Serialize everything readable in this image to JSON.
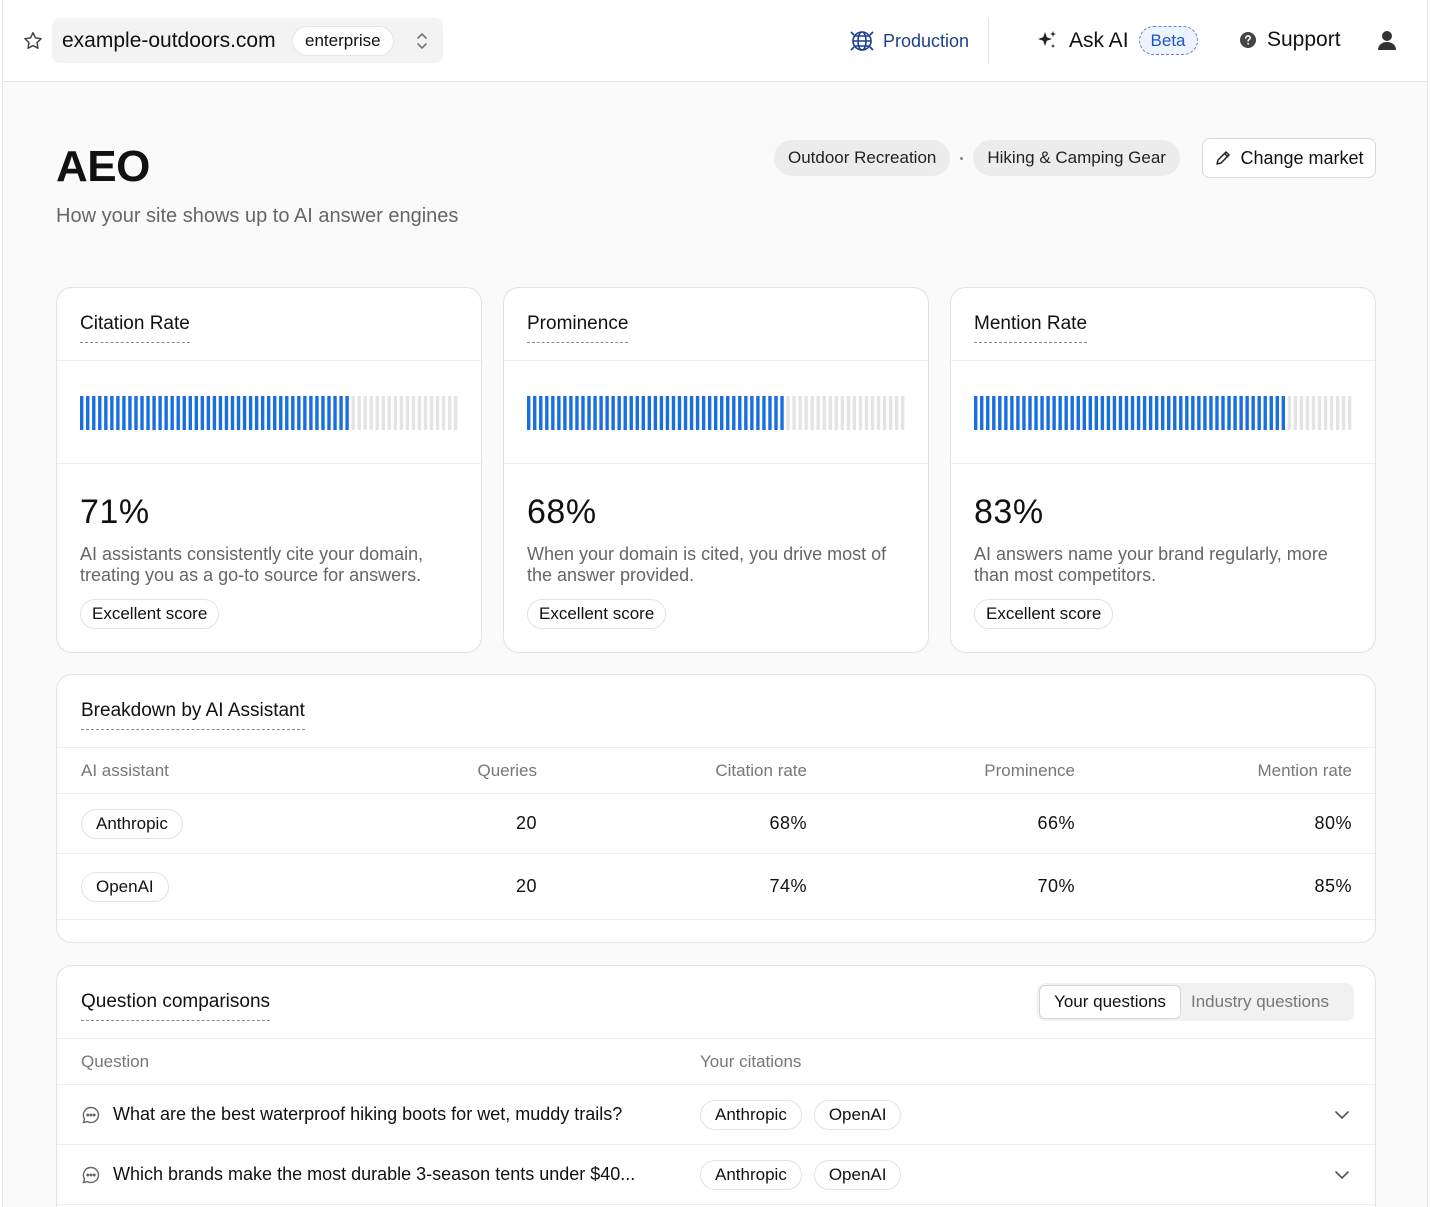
{
  "topbar": {
    "site": "example-outdoors.com",
    "plan": "enterprise",
    "environment": "Production",
    "ask_ai": "Ask AI",
    "beta": "Beta",
    "support": "Support",
    "icons": [
      "star-icon",
      "chevron-updown-icon",
      "globe-icon",
      "sparkle-icon",
      "help-icon",
      "user-icon"
    ]
  },
  "header": {
    "title": "AEO",
    "subtitle": "How your site shows up to AI answer engines",
    "market": [
      "Outdoor Recreation",
      "Hiking & Camping Gear"
    ],
    "change_market": "Change market"
  },
  "metrics": [
    {
      "title": "Citation Rate",
      "value": "71%",
      "fill": 0.71,
      "description": "AI assistants consistently cite your domain, treating you as a go-to source for answers.",
      "badge": "Excellent score"
    },
    {
      "title": "Prominence",
      "value": "68%",
      "fill": 0.68,
      "description": "When your domain is cited, you drive most of the answer provided.",
      "badge": "Excellent score"
    },
    {
      "title": "Mention Rate",
      "value": "83%",
      "fill": 0.83,
      "description": "AI answers name your brand regularly, more than most competitors.",
      "badge": "Excellent score"
    }
  ],
  "colors": {
    "bar_active": "#1a6fe0",
    "bar_inactive": "#e4e4e4"
  },
  "breakdown": {
    "title": "Breakdown by AI Assistant",
    "columns": [
      "AI assistant",
      "Queries",
      "Citation rate",
      "Prominence",
      "Mention rate"
    ],
    "rows": [
      {
        "assistant": "Anthropic",
        "queries": "20",
        "citation": "68%",
        "prominence": "66%",
        "mention": "80%"
      },
      {
        "assistant": "OpenAI",
        "queries": "20",
        "citation": "74%",
        "prominence": "70%",
        "mention": "85%"
      }
    ]
  },
  "questions": {
    "title": "Question comparisons",
    "tabs": [
      "Your questions",
      "Industry questions"
    ],
    "columns": [
      "Question",
      "Your citations"
    ],
    "rows": [
      {
        "question": "What are the best waterproof hiking boots for wet, muddy trails?",
        "citations": [
          "Anthropic",
          "OpenAI"
        ]
      },
      {
        "question": "Which brands make the most durable 3-season tents under $40...",
        "citations": [
          "Anthropic",
          "OpenAI"
        ]
      }
    ]
  }
}
